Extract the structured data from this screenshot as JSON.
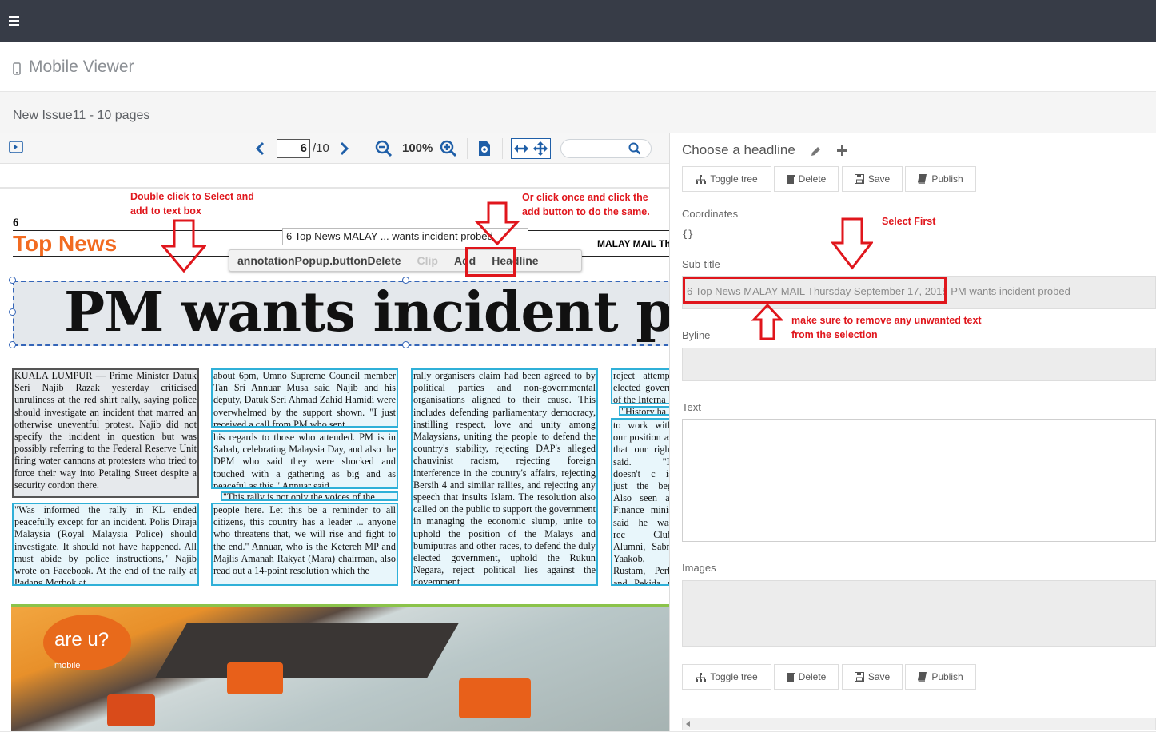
{
  "app": {
    "title": "Mobile Viewer",
    "issue_title": "New Issue11 - 10 pages"
  },
  "toolbar": {
    "page_current": "6",
    "page_total": "/10",
    "zoom": "100%"
  },
  "newspaper": {
    "page_number": "6",
    "section": "Top News",
    "paper_name": "MALAY MAIL Th",
    "headline": "PM wants incident probed",
    "tooltip": "6 Top News MALAY ... wants incident probed",
    "photo_sign": "are u?",
    "photo_sign_sub": "mobile",
    "columns": [
      "KUALA LUMPUR — Prime Minister Datuk Seri Najib Razak yesterday criticised unruliness at the red shirt rally, saying police should investigate an incident that marred an otherwise uneventful protest.\n Najib did not specify the incident in question but was possibly referring to the Federal Reserve Unit firing water cannons at protesters who tried to force their way into Petaling Street despite a security cordon there.",
      "\"Was informed the rally in KL ended peacefully except for an incident. Polis Diraja Malaysia (Royal Malaysia Police) should investigate. It should not have happened. All must abide by police instructions,\" Najib wrote on Facebook.\n At the end of the rally at Padang Merbok at",
      "about 6pm, Umno Supreme Council member Tan Sri Annuar Musa said Najib and his deputy, Datuk Seri Ahmad Zahid Hamidi were overwhelmed by the support shown.\n \"I just received a call from PM who sent",
      "his regards to those who attended. PM is in Sabah, celebrating Malaysia Day, and also the DPM who said they were shocked and touched with a gathering as big and as peaceful as this,\" Annuar said.",
      "\"This rally is not only the voices of the",
      "people here. Let this be a reminder to all citizens, this country has a leader ... anyone who threatens that, we will rise and fight to the end.\"\n Annuar, who is the Ketereh MP and Majlis Amanah Rakyat (Mara) chairman, also read out a 14-point resolution which the",
      "rally organisers claim had been agreed to by political parties and non-governmental organisations aligned to their cause.\n This includes defending parliamentary democracy, instilling respect, love and unity among Malaysians, uniting the people to defend the country's stability, rejecting DAP's alleged chauvinist racism, rejecting foreign interference in the country's affairs, rejecting Bersih 4 and similar rallies, and rejecting any speech that insults Islam.\n The resolution also called on the public to support the government in managing the economic slump, unite to uphold the position of the Malays and bumiputras and other races, to defend the duly elected government, uphold the Rukun Negara, reject political lies against the government",
      "reject attempt elected govern of the Interna",
      "\"History ha",
      "to work with our position as that our right said.\n \"It doesn't c is just the beg\n Also seen at Finance minis said he was rec Club Alumni, Sabri Yaakob, Rustam, Perk and Pekida p Malay Mail Or"
    ]
  },
  "popup": {
    "delete": "annotationPopup.buttonDelete",
    "clip": "Clip",
    "add": "Add",
    "headline": "Headline"
  },
  "panel": {
    "title": "Choose a headline",
    "buttons": {
      "toggle_tree": "Toggle tree",
      "delete": "Delete",
      "save": "Save",
      "publish": "Publish"
    },
    "coordinates_label": "Coordinates",
    "coordinates_value": "{}",
    "subtitle_label": "Sub-title",
    "subtitle_value": "6 Top News MALAY MAIL Thursday September 17, 2015 PM wants incident probed",
    "byline_label": "Byline",
    "text_label": "Text",
    "images_label": "Images"
  },
  "annotations": {
    "double_click_1": "Double click to Select and",
    "double_click_2": "add to text box",
    "click_once_1": "Or click once and click the",
    "click_once_2": "add button to do the same.",
    "select_first": "Select First",
    "remove_text_1": "make sure to remove any unwanted text",
    "remove_text_2": "from the selection"
  },
  "colors": {
    "topbar": "#373c47",
    "accent_orange": "#f26b21",
    "annotation_red": "#e0161c",
    "selection_blue": "#2fb0d8"
  }
}
